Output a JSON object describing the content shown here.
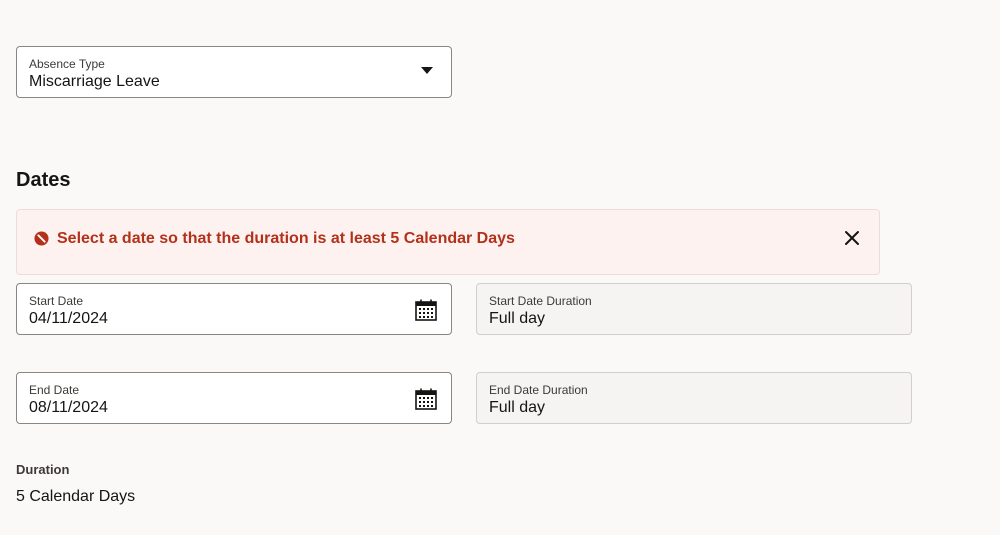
{
  "absence_type": {
    "label": "Absence Type",
    "value": "Miscarriage Leave"
  },
  "dates_section": {
    "title": "Dates"
  },
  "error": {
    "message": "Select a date so that the duration is at least 5 Calendar Days",
    "color": "#b3311b"
  },
  "start_date": {
    "label": "Start Date",
    "value": "04/11/2024"
  },
  "start_date_duration": {
    "label": "Start Date Duration",
    "value": "Full day"
  },
  "end_date": {
    "label": "End Date",
    "value": "08/11/2024"
  },
  "end_date_duration": {
    "label": "End Date Duration",
    "value": "Full day"
  },
  "duration": {
    "label": "Duration",
    "value": "5 Calendar Days"
  },
  "icons": {
    "dropdown": "chevron-down-icon",
    "calendar": "calendar-icon",
    "error": "error-icon",
    "close": "close-icon"
  }
}
